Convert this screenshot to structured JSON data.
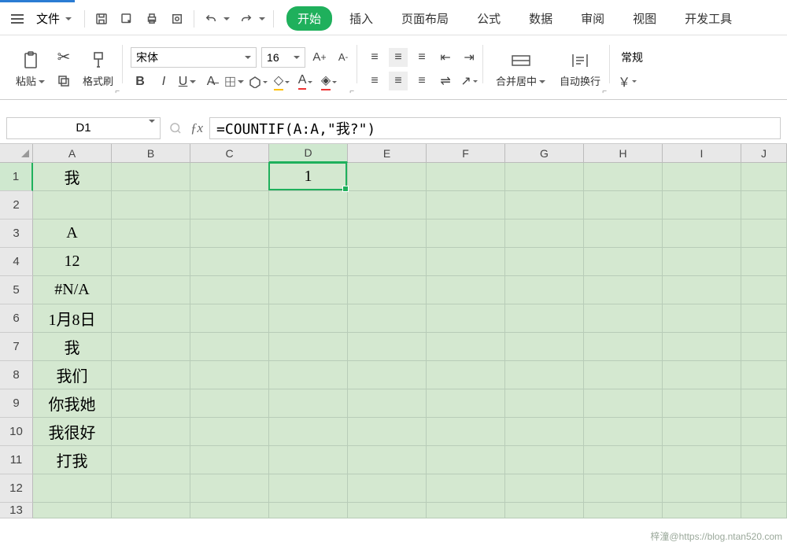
{
  "file_menu": {
    "label": "文件"
  },
  "tabs": {
    "start": "开始",
    "insert": "插入",
    "layout": "页面布局",
    "formula": "公式",
    "data": "数据",
    "review": "审阅",
    "view": "视图",
    "dev": "开发工具"
  },
  "ribbon": {
    "paste": "粘贴",
    "format_painter": "格式刷",
    "font_name": "宋体",
    "font_size": "16",
    "merge_center": "合并居中",
    "wrap_text": "自动换行",
    "number_format": "常规",
    "currency": "￥"
  },
  "namebox": {
    "value": "D1"
  },
  "formula": {
    "value": "=COUNTIF(A:A,\"我?\")"
  },
  "columns": [
    "A",
    "B",
    "C",
    "D",
    "E",
    "F",
    "G",
    "H",
    "I",
    "J"
  ],
  "selected_col_index": 3,
  "selected_row_index": 0,
  "active_cell": {
    "col": 3,
    "row": 0
  },
  "rows": [
    {
      "n": "1",
      "cells": [
        "我",
        "",
        "",
        "1",
        "",
        "",
        "",
        "",
        "",
        ""
      ]
    },
    {
      "n": "2",
      "cells": [
        "",
        "",
        "",
        "",
        "",
        "",
        "",
        "",
        "",
        ""
      ]
    },
    {
      "n": "3",
      "cells": [
        "A",
        "",
        "",
        "",
        "",
        "",
        "",
        "",
        "",
        ""
      ]
    },
    {
      "n": "4",
      "cells": [
        "12",
        "",
        "",
        "",
        "",
        "",
        "",
        "",
        "",
        ""
      ]
    },
    {
      "n": "5",
      "cells": [
        "#N/A",
        "",
        "",
        "",
        "",
        "",
        "",
        "",
        "",
        ""
      ]
    },
    {
      "n": "6",
      "cells": [
        "1月8日",
        "",
        "",
        "",
        "",
        "",
        "",
        "",
        "",
        ""
      ]
    },
    {
      "n": "7",
      "cells": [
        "我",
        "",
        "",
        "",
        "",
        "",
        "",
        "",
        "",
        ""
      ]
    },
    {
      "n": "8",
      "cells": [
        "我们",
        "",
        "",
        "",
        "",
        "",
        "",
        "",
        "",
        ""
      ]
    },
    {
      "n": "9",
      "cells": [
        "你我她",
        "",
        "",
        "",
        "",
        "",
        "",
        "",
        "",
        ""
      ]
    },
    {
      "n": "10",
      "cells": [
        "我很好",
        "",
        "",
        "",
        "",
        "",
        "",
        "",
        "",
        ""
      ]
    },
    {
      "n": "11",
      "cells": [
        "打我",
        "",
        "",
        "",
        "",
        "",
        "",
        "",
        "",
        ""
      ]
    },
    {
      "n": "12",
      "cells": [
        "",
        "",
        "",
        "",
        "",
        "",
        "",
        "",
        "",
        ""
      ]
    },
    {
      "n": "13",
      "cells": [
        "",
        "",
        "",
        "",
        "",
        "",
        "",
        "",
        "",
        ""
      ]
    }
  ],
  "watermark": "梓潼@https://blog.ntan520.com"
}
